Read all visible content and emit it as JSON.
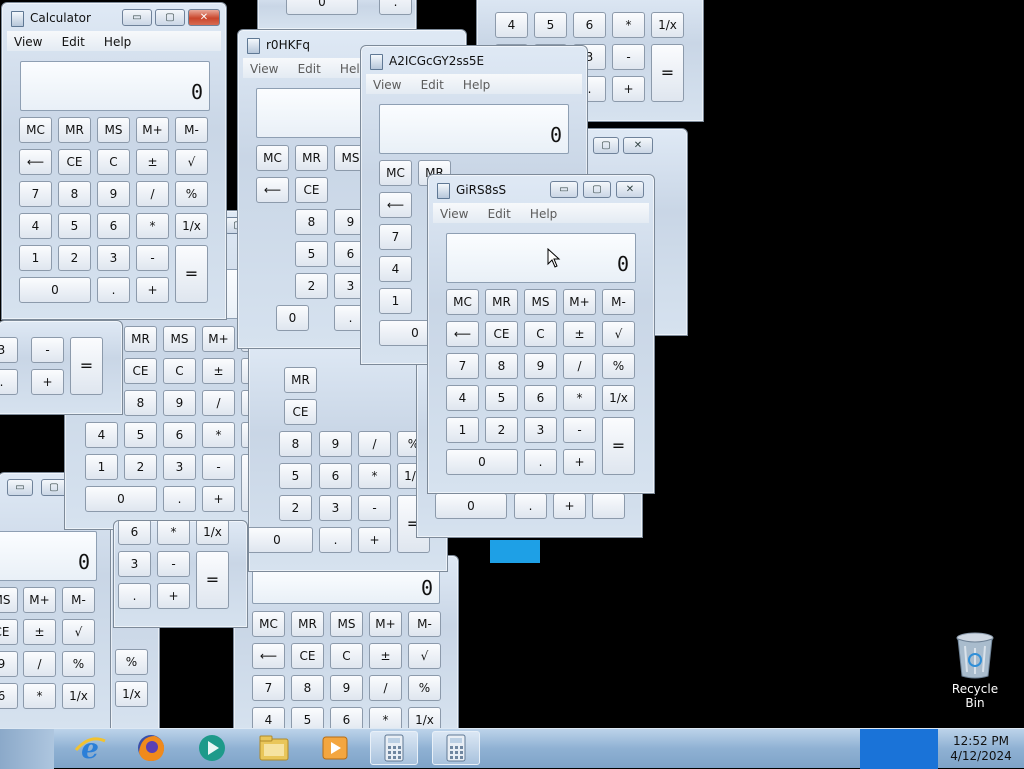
{
  "menu": {
    "view": "View",
    "edit": "Edit",
    "help": "Help"
  },
  "display": {
    "value": "0"
  },
  "keys": {
    "mc": "MC",
    "mr": "MR",
    "ms": "MS",
    "mplus": "M+",
    "mminus": "M-",
    "back": "⟵",
    "ce": "CE",
    "c": "C",
    "pm": "±",
    "sqrt": "√",
    "n7": "7",
    "n8": "8",
    "n9": "9",
    "div": "/",
    "pct": "%",
    "n4": "4",
    "n5": "5",
    "n6": "6",
    "mul": "*",
    "recip": "1/x",
    "n1": "1",
    "n2": "2",
    "n3": "3",
    "sub": "-",
    "eq": "=",
    "n0": "0",
    "dot": ".",
    "add": "+"
  },
  "windows": {
    "calculator": {
      "title": "Calculator"
    },
    "w_r0hkfq": {
      "title": "r0HKFq"
    },
    "w_a2icgcgy": {
      "title": "A2ICGcGY2ss5E"
    },
    "w_girs8ss": {
      "title": "GiRS8sS"
    }
  },
  "desktop": {
    "recycle_bin_label": "Recycle Bin"
  },
  "taskbar": {
    "clock_time": "12:52 PM",
    "clock_date": "4/12/2024",
    "apps": [
      {
        "name": "internet-explorer"
      },
      {
        "name": "firefox"
      },
      {
        "name": "media-app"
      },
      {
        "name": "file-explorer"
      },
      {
        "name": "media-player"
      },
      {
        "name": "calculator"
      },
      {
        "name": "calculator"
      }
    ]
  },
  "colors": {
    "desktop": "#000000",
    "taskbar": "#8fb1d3",
    "tray": "#1a73d8",
    "highlight": "#1ea0e6"
  }
}
